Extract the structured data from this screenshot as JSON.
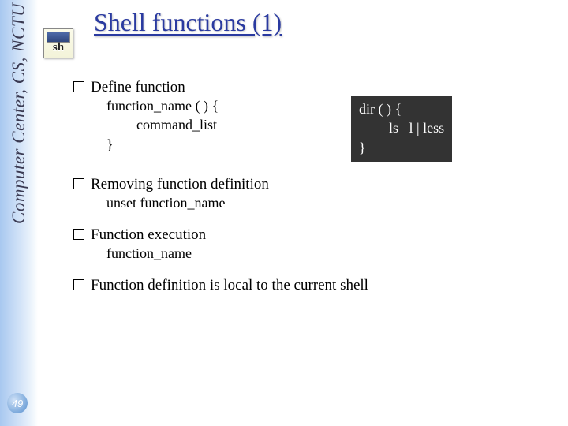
{
  "sidebar": {
    "label": "Computer Center, CS, NCTU",
    "page_number": "49"
  },
  "icon": {
    "sh_label": "sh"
  },
  "title": "Shell functions (1)",
  "items": {
    "define": {
      "heading": "Define function",
      "syntax": {
        "line1": "function_name ( ) {",
        "line2": "command_list",
        "line3": "}"
      },
      "example": {
        "line1": "dir ( ) {",
        "line2": "ls –l | less",
        "line3": "}"
      }
    },
    "remove": {
      "heading": "Removing function definition",
      "sub": "unset function_name"
    },
    "exec": {
      "heading": "Function execution",
      "sub": "function_name"
    },
    "scope": {
      "heading": "Function definition is local to the current shell"
    }
  }
}
